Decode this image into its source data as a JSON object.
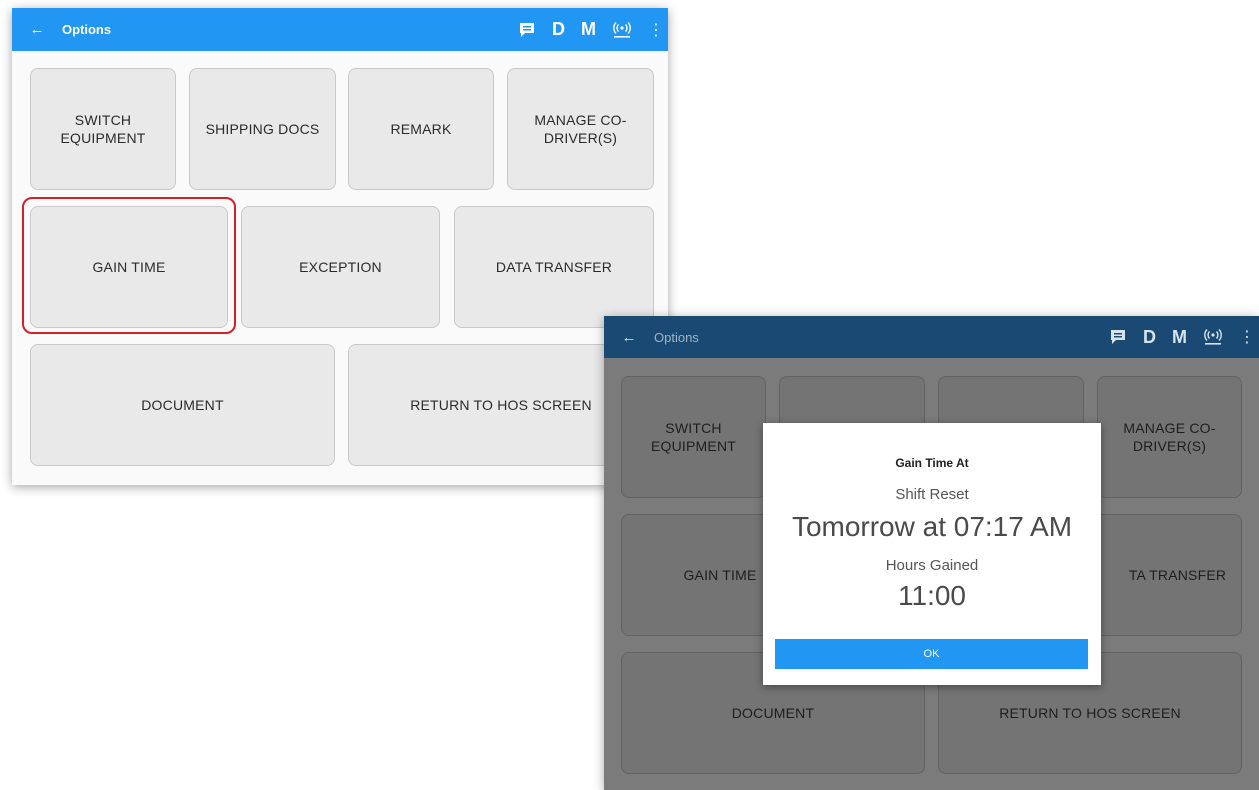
{
  "screen1": {
    "title": "Options",
    "back_icon": "arrow-left-icon",
    "tools": {
      "message_icon": "message-icon",
      "d_label": "D",
      "m_label": "M",
      "eld_icon": "eld-signal-icon",
      "more_icon": "more-vert-icon"
    },
    "buttons": {
      "switch_equipment": "SWITCH\nEQUIPMENT",
      "shipping_docs": "SHIPPING DOCS",
      "remark": "REMARK",
      "manage_co_drivers": "MANAGE CO-\nDRIVER(S)",
      "gain_time": "GAIN TIME",
      "exception": "EXCEPTION",
      "data_transfer": "DATA TRANSFER",
      "document": "DOCUMENT",
      "return_to_hos": "RETURN TO HOS SCREEN"
    },
    "highlight_color": "#d3202b"
  },
  "screen2": {
    "title": "Options",
    "tools": {
      "d_label": "D",
      "m_label": "M"
    },
    "buttons": {
      "switch_equipment": "SWITCH\nEQUIPMENT",
      "manage_co_drivers": "MANAGE CO-\nDRIVER(S)",
      "gain_time": "GAIN TIME",
      "data_transfer": "TA TRANSFER",
      "document": "DOCUMENT",
      "return_to_hos": "RETURN TO HOS SCREEN"
    },
    "dialog": {
      "title": "Gain Time At",
      "shift_label": "Shift Reset",
      "shift_time": "Tomorrow at 07:17 AM",
      "hours_label": "Hours Gained",
      "hours_value": "11:00",
      "ok_label": "OK"
    }
  },
  "colors": {
    "appbar": "#2196f3",
    "appbar_dimmed": "#1a4a73",
    "ok_button": "#2196f3"
  }
}
